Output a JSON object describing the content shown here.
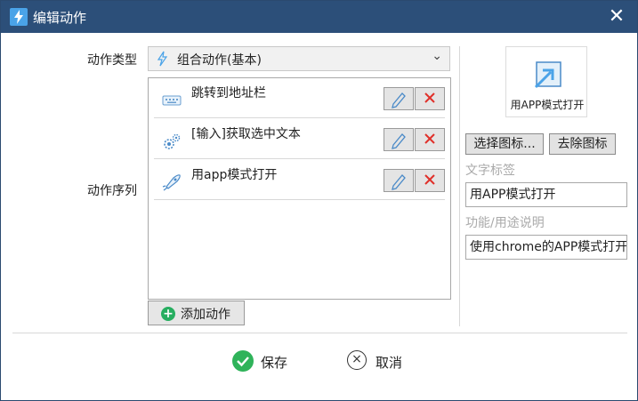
{
  "window": {
    "title": "编辑动作",
    "close_glyph": "✕"
  },
  "form": {
    "action_type_label": "动作类型",
    "action_type_value": "组合动作(基本)",
    "action_seq_label": "动作序列"
  },
  "sequence": {
    "items": [
      {
        "label": "跳转到地址栏",
        "icon": "keyboard-icon"
      },
      {
        "label": "[输入]获取选中文本",
        "icon": "gear-icon"
      },
      {
        "label": "用app模式打开",
        "icon": "rocket-icon"
      }
    ],
    "add_label": "添加动作"
  },
  "side": {
    "preview_label": "用APP模式打开",
    "choose_icon_label": "选择图标...",
    "remove_icon_label": "去除图标",
    "text_label_title": "文字标签",
    "text_label_value": "用APP模式打开",
    "desc_title": "功能/用途说明",
    "desc_value": "使用chrome的APP模式打开"
  },
  "footer": {
    "save_label": "保存",
    "cancel_label": "取消"
  },
  "colors": {
    "titlebar": "#2c4f79",
    "accent": "#4aa3e8",
    "delete": "#e0302a",
    "save": "#2fb35a"
  }
}
